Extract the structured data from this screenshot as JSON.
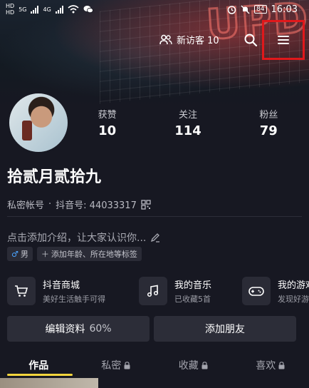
{
  "status": {
    "time": "16:03",
    "battery": "84",
    "hd1": "HD",
    "hd2": "HD",
    "net1": "5G",
    "net2": "4G"
  },
  "header": {
    "visitors_label": "新访客 10"
  },
  "profile": {
    "stats": [
      {
        "label": "获赞",
        "value": "10"
      },
      {
        "label": "关注",
        "value": "114"
      },
      {
        "label": "粉丝",
        "value": "79"
      }
    ],
    "name": "拾贰月贰拾九",
    "private_account": "私密帐号",
    "dot": "·",
    "douyin_id": "抖音号: 44033317",
    "intro": "点击添加介绍，让大家认识你...",
    "tags": [
      {
        "label": "男",
        "icon": "male-icon"
      },
      {
        "label": "添加年龄、所在地等标签",
        "icon": "plus-icon"
      }
    ]
  },
  "services": [
    {
      "title": "抖音商城",
      "subtitle": "美好生活触手可得",
      "icon": "cart-icon"
    },
    {
      "title": "我的音乐",
      "subtitle": "已收藏5首",
      "icon": "music-note-icon"
    },
    {
      "title": "我的游戏",
      "subtitle": "发现好游",
      "icon": "gamepad-icon"
    }
  ],
  "actions": {
    "edit_label": "编辑资料",
    "edit_pct": "60%",
    "add_friend_label": "添加朋友"
  },
  "tabs": [
    {
      "label": "作品",
      "locked": false
    },
    {
      "label": "私密",
      "locked": true
    },
    {
      "label": "收藏",
      "locked": true
    },
    {
      "label": "喜欢",
      "locked": true
    }
  ],
  "colors": {
    "background": "#171822",
    "accent_underline": "#f2d43c",
    "highlight_box": "#e0181b"
  }
}
